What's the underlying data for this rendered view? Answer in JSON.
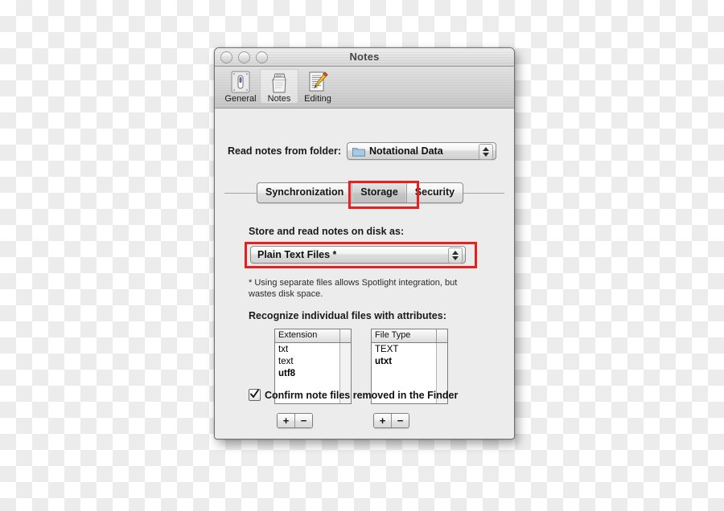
{
  "window": {
    "title": "Notes",
    "traffic_lights": [
      "close-button",
      "minimize-button",
      "zoom-button"
    ]
  },
  "toolbar": {
    "items": [
      {
        "label": "General",
        "icon": "general-icon",
        "selected": false
      },
      {
        "label": "Notes",
        "icon": "notes-bag-icon",
        "selected": true
      },
      {
        "label": "Editing",
        "icon": "editing-pencil-icon",
        "selected": false
      }
    ]
  },
  "folder_row": {
    "label": "Read notes from folder:",
    "popup_value": "Notational Data",
    "icon": "folder-icon"
  },
  "tabs": {
    "items": [
      {
        "label": "Synchronization",
        "active": false
      },
      {
        "label": "Storage",
        "active": true
      },
      {
        "label": "Security",
        "active": false
      }
    ]
  },
  "storage": {
    "disk_format_label": "Store and read notes on disk as:",
    "disk_format_value": "Plain Text Files *",
    "footnote": "* Using separate files allows Spotlight integration, but wastes disk space.",
    "attributes_label": "Recognize individual files with attributes:"
  },
  "extension_table": {
    "header": "Extension",
    "rows": [
      {
        "value": "txt",
        "bold": false
      },
      {
        "value": "text",
        "bold": false
      },
      {
        "value": "utf8",
        "bold": true
      }
    ],
    "add_label": "+",
    "remove_label": "−"
  },
  "filetype_table": {
    "header": "File Type",
    "rows": [
      {
        "value": "TEXT",
        "bold": false
      },
      {
        "value": "utxt",
        "bold": true
      }
    ],
    "add_label": "+",
    "remove_label": "−"
  },
  "confirm_checkbox": {
    "label": "Confirm note files removed in the Finder",
    "checked": true
  },
  "annotations": {
    "highlight_color": "#ee1c1c",
    "boxes": [
      {
        "target": "storage-tab"
      },
      {
        "target": "disk-format-popup"
      }
    ]
  }
}
